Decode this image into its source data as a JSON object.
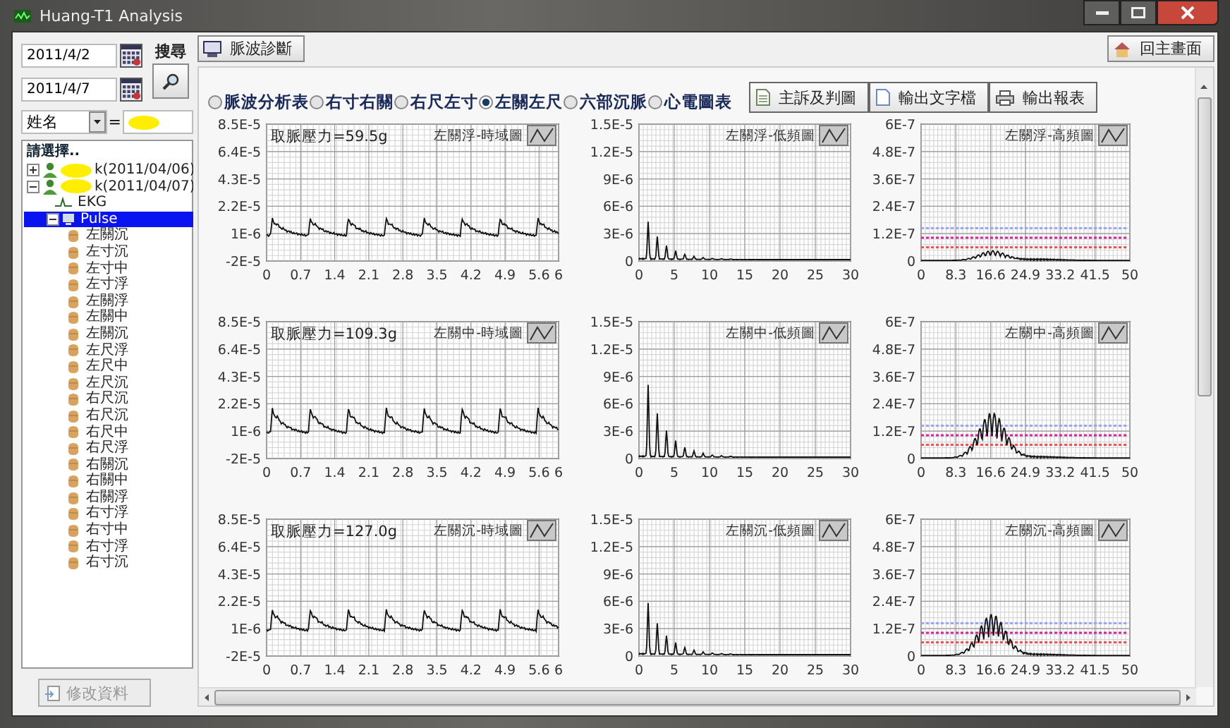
{
  "window": {
    "title": "Huang-T1 Analysis"
  },
  "search": {
    "start_date": "2011/4/2",
    "end_date": "2011/4/7",
    "search_label": "搜尋",
    "field": "姓名",
    "equals": "=",
    "name_redacted": true
  },
  "tree": {
    "header": "請選擇..",
    "items": [
      {
        "label": "k(2011/04/06)",
        "kind": "person",
        "redacted": true,
        "expanded": false,
        "selected": false
      },
      {
        "label": "k(2011/04/07)",
        "kind": "person",
        "redacted": true,
        "expanded": true,
        "selected": false,
        "children": [
          {
            "label": "EKG",
            "kind": "ekg",
            "selected": false
          },
          {
            "label": "Pulse",
            "kind": "pulse",
            "expanded": true,
            "selected": true,
            "children": [
              {
                "label": "左關沉"
              },
              {
                "label": "左寸沉"
              },
              {
                "label": "左寸中"
              },
              {
                "label": "左寸浮"
              },
              {
                "label": "左關浮"
              },
              {
                "label": "左關中"
              },
              {
                "label": "左關沉"
              },
              {
                "label": "左尺浮"
              },
              {
                "label": "左尺中"
              },
              {
                "label": "左尺沉"
              },
              {
                "label": "右尺沉"
              },
              {
                "label": "右尺沉"
              },
              {
                "label": "右尺中"
              },
              {
                "label": "右尺浮"
              },
              {
                "label": "右關沉"
              },
              {
                "label": "右關中"
              },
              {
                "label": "右關浮"
              },
              {
                "label": "右寸浮"
              },
              {
                "label": "右寸中"
              },
              {
                "label": "右寸浮"
              },
              {
                "label": "右寸沉"
              }
            ]
          }
        ]
      }
    ]
  },
  "edit_button": {
    "label": "修改資料",
    "disabled": true
  },
  "top_buttons": {
    "left": "脈波診斷",
    "right": "回主畫面"
  },
  "views": [
    {
      "label": "脈波分析表",
      "selected": false
    },
    {
      "label": "右寸右關",
      "selected": false
    },
    {
      "label": "右尺左寸",
      "selected": false
    },
    {
      "label": "左關左尺",
      "selected": true
    },
    {
      "label": "六部沉脈",
      "selected": false
    },
    {
      "label": "心電圖表",
      "selected": false
    }
  ],
  "actions": [
    {
      "label": "主訴及判圖"
    },
    {
      "label": "輸出文字檔"
    },
    {
      "label": "輸出報表"
    }
  ],
  "chart_rows": [
    {
      "charts": [
        {
          "kind": "time",
          "title": "左關浮-時域圖",
          "note": "取脈壓力=59.5g",
          "y_ticks": [
            "8.5E-5",
            "6.4E-5",
            "4.3E-5",
            "2.2E-5",
            "1E-6",
            "-2E-5"
          ],
          "x_ticks": [
            "0",
            "0.7",
            "1.4",
            "2.1",
            "2.8",
            "3.5",
            "4.2",
            "4.9",
            "5.6",
            "6"
          ]
        },
        {
          "kind": "low",
          "title": "左關浮-低頻圖",
          "y_ticks": [
            "1.5E-5",
            "1.2E-5",
            "9E-6",
            "6E-6",
            "3E-6",
            "0"
          ],
          "x_ticks": [
            "0",
            "5",
            "10",
            "15",
            "20",
            "25",
            "30"
          ]
        },
        {
          "kind": "high",
          "title": "左關浮-高頻圖",
          "y_ticks": [
            "6E-7",
            "4.8E-7",
            "3.6E-7",
            "2.4E-7",
            "1.2E-7",
            "0"
          ],
          "x_ticks": [
            "0",
            "8.3",
            "16.6",
            "24.9",
            "33.2",
            "41.5",
            "50"
          ],
          "reference_lines": [
            {
              "color": "#9aa4ff"
            },
            {
              "color": "#e0209a"
            },
            {
              "color": "#ff4a4a"
            }
          ]
        }
      ]
    },
    {
      "charts": [
        {
          "kind": "time",
          "title": "左關中-時域圖",
          "note": "取脈壓力=109.3g",
          "y_ticks": [
            "8.5E-5",
            "6.4E-5",
            "4.3E-5",
            "2.2E-5",
            "1E-6",
            "-2E-5"
          ],
          "x_ticks": [
            "0",
            "0.7",
            "1.4",
            "2.1",
            "2.8",
            "3.5",
            "4.2",
            "4.9",
            "5.6",
            "6"
          ]
        },
        {
          "kind": "low",
          "title": "左關中-低頻圖",
          "y_ticks": [
            "1.5E-5",
            "1.2E-5",
            "9E-6",
            "6E-6",
            "3E-6",
            "0"
          ],
          "x_ticks": [
            "0",
            "5",
            "10",
            "15",
            "20",
            "25",
            "30"
          ]
        },
        {
          "kind": "high",
          "title": "左關中-高頻圖",
          "y_ticks": [
            "6E-7",
            "4.8E-7",
            "3.6E-7",
            "2.4E-7",
            "1.2E-7",
            "0"
          ],
          "x_ticks": [
            "0",
            "8.3",
            "16.6",
            "24.9",
            "33.2",
            "41.5",
            "50"
          ],
          "reference_lines": [
            {
              "color": "#9aa4ff"
            },
            {
              "color": "#e0209a"
            },
            {
              "color": "#ff4a4a"
            }
          ]
        }
      ]
    },
    {
      "charts": [
        {
          "kind": "time",
          "title": "左關沉-時域圖",
          "note": "取脈壓力=127.0g",
          "y_ticks": [
            "8.5E-5",
            "6.4E-5",
            "4.3E-5",
            "2.2E-5",
            "1E-6",
            "-2E-5"
          ],
          "x_ticks": [
            "0",
            "0.7",
            "1.4",
            "2.1",
            "2.8",
            "3.5",
            "4.2",
            "4.9",
            "5.6",
            "6"
          ]
        },
        {
          "kind": "low",
          "title": "左關沉-低頻圖",
          "y_ticks": [
            "1.5E-5",
            "1.2E-5",
            "9E-6",
            "6E-6",
            "3E-6",
            "0"
          ],
          "x_ticks": [
            "0",
            "5",
            "10",
            "15",
            "20",
            "25",
            "30"
          ]
        },
        {
          "kind": "high",
          "title": "左關沉-高頻圖",
          "y_ticks": [
            "6E-7",
            "4.8E-7",
            "3.6E-7",
            "2.4E-7",
            "1.2E-7",
            "0"
          ],
          "x_ticks": [
            "0",
            "8.3",
            "16.6",
            "24.9",
            "33.2",
            "41.5",
            "50"
          ],
          "reference_lines": [
            {
              "color": "#9aa4ff"
            },
            {
              "color": "#e0209a"
            },
            {
              "color": "#ff4a4a"
            }
          ]
        }
      ]
    }
  ]
}
